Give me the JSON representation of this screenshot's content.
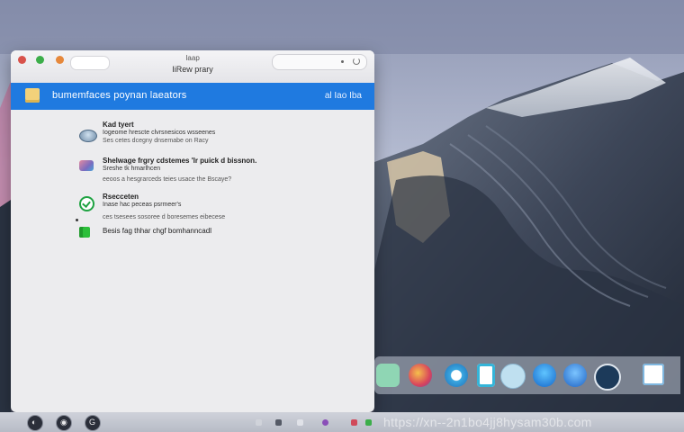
{
  "window": {
    "tab_label": "",
    "title_top": "Iaap",
    "title": "IiRew prary",
    "search_placeholder": ""
  },
  "header": {
    "title": "bumemfaces poynan laeators",
    "right": "al Iao  Iba"
  },
  "items": [
    {
      "icon": "disk-icon",
      "title": "Kad tyert",
      "lines": [
        "Iogeome hrescte clvrsnesicos wsseenes",
        "Ses cetes dcegny dnsemabe on Racy"
      ]
    },
    {
      "icon": "box-icon",
      "title": "Shelwage frgry cdstemes 'lr puick d bissnon.",
      "lines": [
        "Sreshe tk  hmarlhcen",
        "eeoos a hesgrarceds  teies usace the Bscaye?"
      ]
    },
    {
      "icon": "check-icon",
      "title": "Rsecceten",
      "lines": [
        "Inase hac peceas psrmeer's",
        "ces tsesees sosoree d boresemes eibecese"
      ]
    },
    {
      "icon": "green-icon",
      "title": "Besis fag thhar chgf bomhanncadl",
      "lines": []
    }
  ],
  "watermark": "https://xn--2n1bo4jj8hysam30b.com",
  "colors": {
    "header_blue": "#1f7ae0",
    "window_bg": "#ececee"
  }
}
